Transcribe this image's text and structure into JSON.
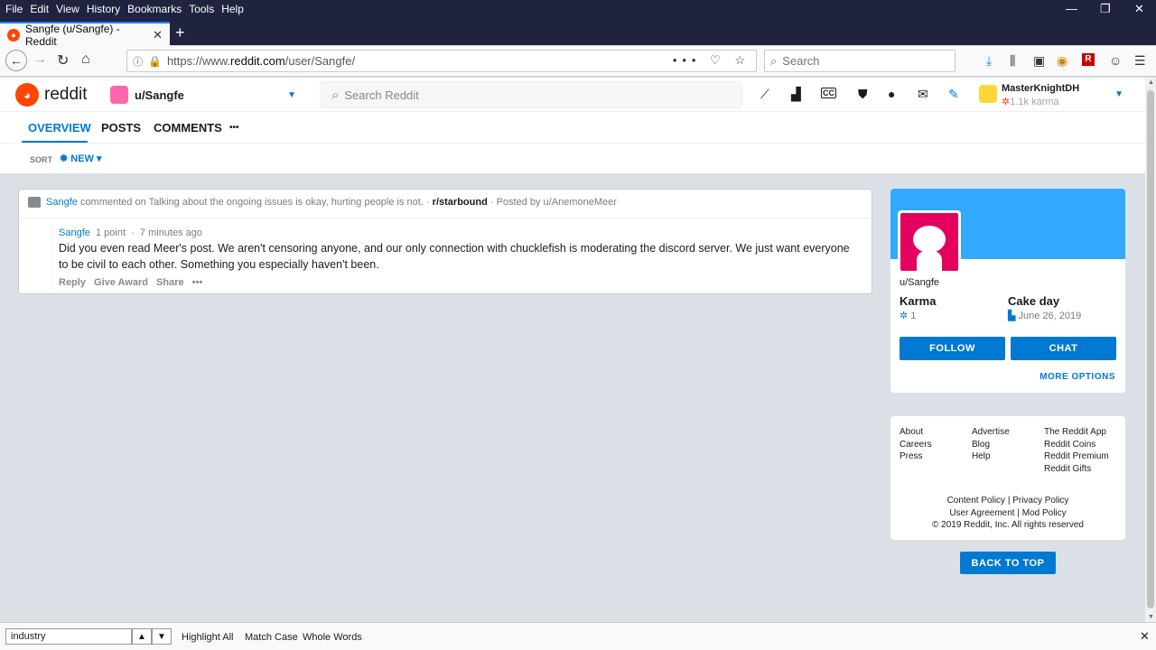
{
  "menubar": {
    "items": [
      "File",
      "Edit",
      "View",
      "History",
      "Bookmarks",
      "Tools",
      "Help"
    ]
  },
  "browser": {
    "tab_title": "Sangfe (u/Sangfe) - Reddit",
    "url_prefix": "https://www.",
    "url_domain": "reddit.com",
    "url_path": "/user/Sangfe/",
    "search_placeholder": "Search"
  },
  "header": {
    "logo_text": "reddit",
    "user_dropdown": "u/Sangfe",
    "search_placeholder": "Search Reddit",
    "account_name": "MasterKnightDH",
    "account_karma": "1.1k karma"
  },
  "profile_tabs": [
    "OVERVIEW",
    "POSTS",
    "COMMENTS",
    "•••"
  ],
  "sort": {
    "label": "SORT",
    "value": "NEW"
  },
  "comment_card": {
    "author": "Sangfe",
    "commented_on": "commented on",
    "post_title": "Talking about the ongoing issues is okay, hurting people is not.",
    "subreddit": "r/starbound",
    "posted_by": "· Posted by u/AnemoneMeer",
    "points": "1 point",
    "time": "7 minutes ago",
    "body": "Did you even read Meer's post. We aren't censoring anyone, and our only connection with chucklefish is moderating the discord server. We just want everyone to be civil to each other. Something you especially haven't been.",
    "actions": [
      "Reply",
      "Give Award",
      "Share",
      "•••"
    ]
  },
  "profile": {
    "username": "u/Sangfe",
    "karma_label": "Karma",
    "karma_value": "1",
    "cakeday_label": "Cake day",
    "cakeday_value": "June 26, 2019",
    "follow": "FOLLOW",
    "chat": "CHAT",
    "more_options": "MORE OPTIONS"
  },
  "footer": {
    "col1": [
      "About",
      "Careers",
      "Press"
    ],
    "col2": [
      "Advertise",
      "Blog",
      "Help"
    ],
    "col3": [
      "The Reddit App",
      "Reddit Coins",
      "Reddit Premium",
      "Reddit Gifts"
    ],
    "legal1": "Content Policy |  Privacy Policy",
    "legal2": "User Agreement |  Mod Policy",
    "legal3": "© 2019 Reddit, Inc. All rights reserved"
  },
  "back_to_top": "BACK TO TOP",
  "findbar": {
    "value": "industry",
    "options": [
      "Highlight All",
      "Match Case",
      "Whole Words"
    ]
  }
}
